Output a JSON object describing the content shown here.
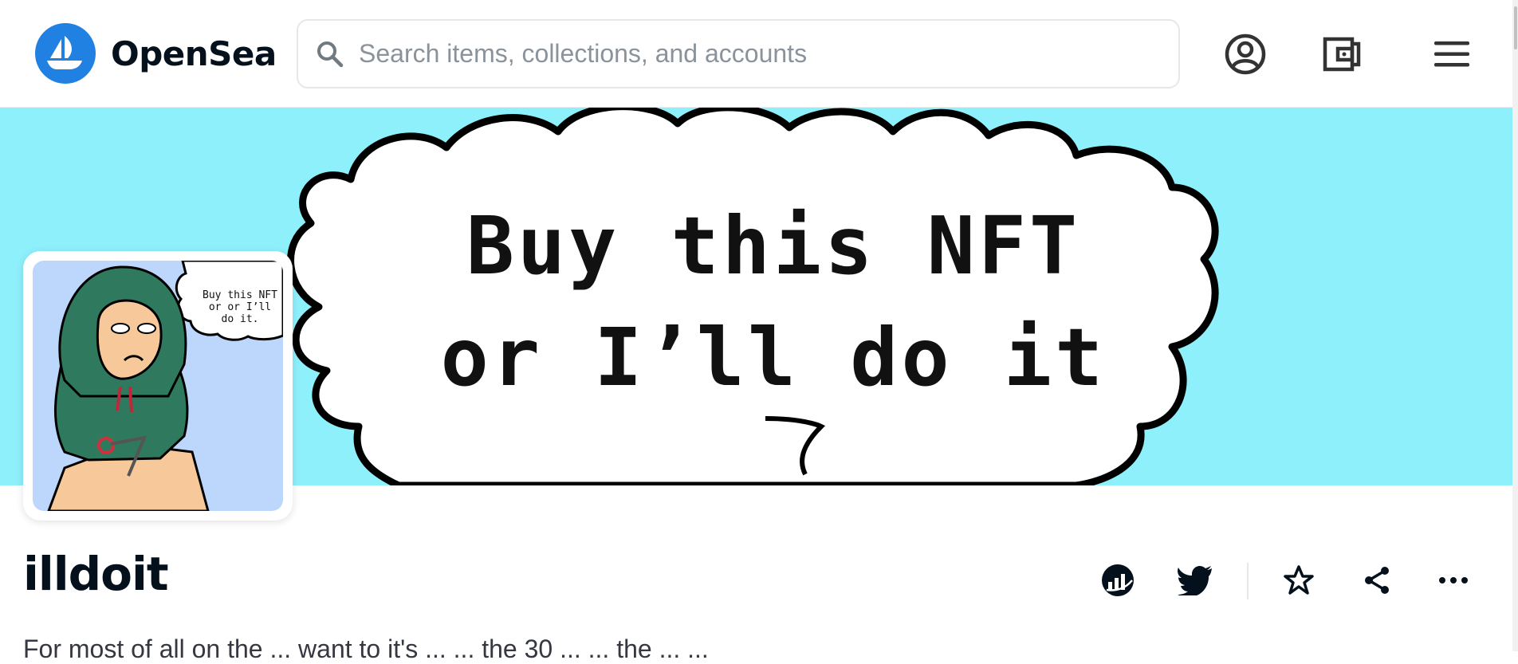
{
  "header": {
    "brand": "OpenSea",
    "search_placeholder": "Search items, collections, and accounts",
    "brand_color": "#2081e2"
  },
  "banner": {
    "line1": "Buy this NFT",
    "line2": "or I’ll do it",
    "background": "#8ef0fb"
  },
  "avatar": {
    "bubble_text": "Buy this NFT or or I’ll do it."
  },
  "profile": {
    "name": "illdoit",
    "description": "For most of all on the ... want to it's ... ... the 30 ... ... the ... ..."
  },
  "icons": {
    "account": "account-icon",
    "wallet": "wallet-icon",
    "menu": "menu-icon",
    "activity": "activity-icon",
    "twitter": "twitter-icon",
    "favorite": "star-icon",
    "share": "share-icon",
    "more": "more-icon"
  }
}
